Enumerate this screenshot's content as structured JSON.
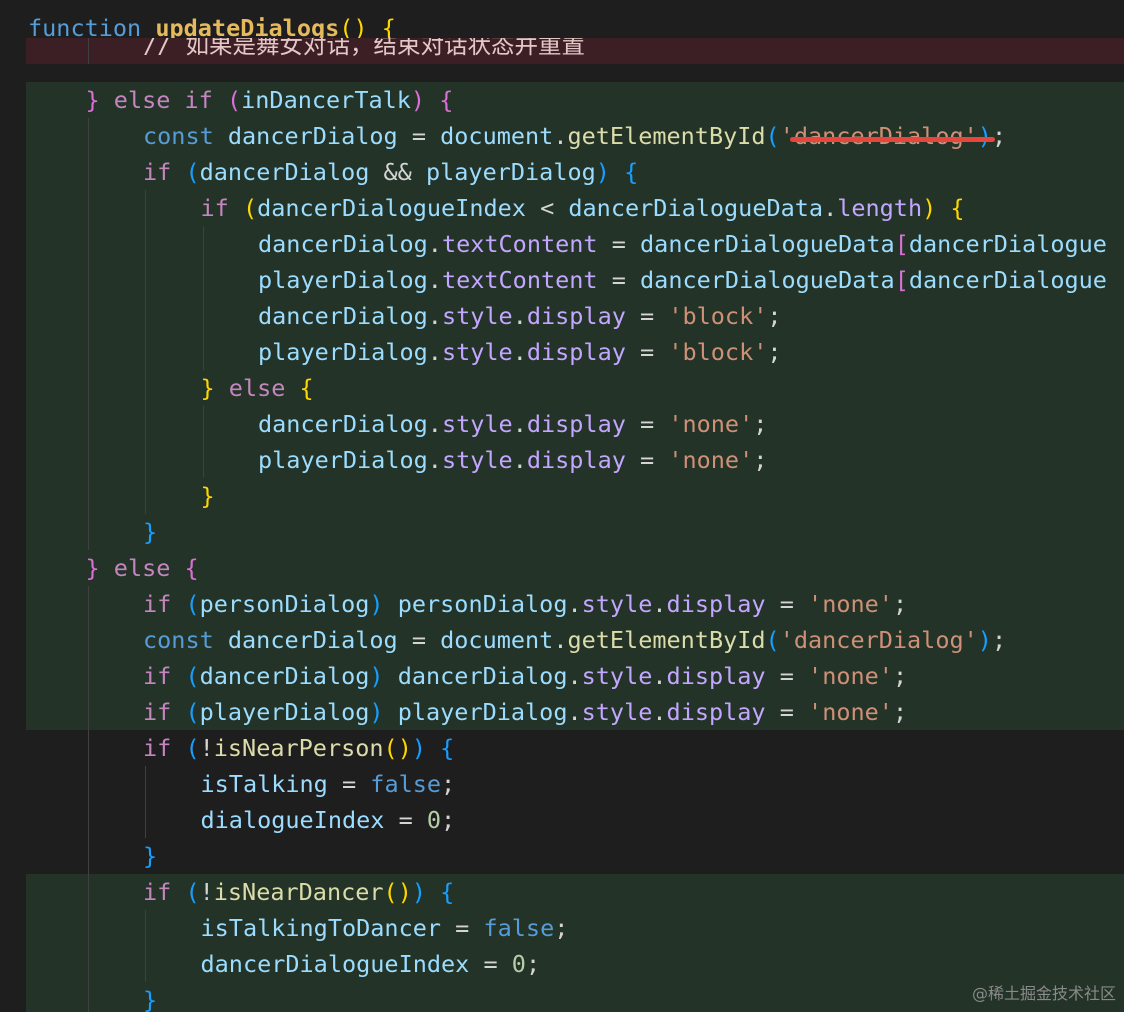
{
  "editor": {
    "watermark": "@稀土掘金技术社区"
  },
  "lines": [
    {
      "kind": "plain",
      "indent": 0,
      "tokens": [
        {
          "t": "function ",
          "c": "kw"
        },
        {
          "t": "updateDialogs",
          "c": "fn-def"
        },
        {
          "t": "()",
          "c": "b1"
        },
        {
          "t": " ",
          "c": "op"
        },
        {
          "t": "{",
          "c": "b1"
        }
      ]
    },
    {
      "kind": "removed",
      "indent": 2,
      "tokens": [
        {
          "t": "// 如果是舞女对话，结束对话状态并重置",
          "c": "comment"
        }
      ]
    },
    {
      "kind": "added",
      "indent": 1,
      "tokens": [
        {
          "t": "} ",
          "c": "b2"
        },
        {
          "t": "else if ",
          "c": "kw-flow"
        },
        {
          "t": "(",
          "c": "b2"
        },
        {
          "t": "inDancerTalk",
          "c": "var"
        },
        {
          "t": ")",
          "c": "b2"
        },
        {
          "t": " ",
          "c": "op"
        },
        {
          "t": "{",
          "c": "b2"
        }
      ]
    },
    {
      "kind": "added",
      "indent": 2,
      "tokens": [
        {
          "t": "const ",
          "c": "kw"
        },
        {
          "t": "dancerDialog",
          "c": "var"
        },
        {
          "t": " = ",
          "c": "op"
        },
        {
          "t": "document",
          "c": "var"
        },
        {
          "t": ".",
          "c": "op"
        },
        {
          "t": "getElementById",
          "c": "fn"
        },
        {
          "t": "(",
          "c": "b3"
        },
        {
          "t": "'dancerDialog'",
          "c": "str"
        },
        {
          "t": ")",
          "c": "b3"
        },
        {
          "t": ";",
          "c": "op"
        }
      ]
    },
    {
      "kind": "added",
      "indent": 2,
      "tokens": [
        {
          "t": "if ",
          "c": "kw-flow"
        },
        {
          "t": "(",
          "c": "b3"
        },
        {
          "t": "dancerDialog",
          "c": "var"
        },
        {
          "t": " && ",
          "c": "op"
        },
        {
          "t": "playerDialog",
          "c": "var"
        },
        {
          "t": ")",
          "c": "b3"
        },
        {
          "t": " ",
          "c": "op"
        },
        {
          "t": "{",
          "c": "b3"
        }
      ]
    },
    {
      "kind": "added",
      "indent": 3,
      "tokens": [
        {
          "t": "if ",
          "c": "kw-flow"
        },
        {
          "t": "(",
          "c": "b1"
        },
        {
          "t": "dancerDialogueIndex",
          "c": "var"
        },
        {
          "t": " < ",
          "c": "op"
        },
        {
          "t": "dancerDialogueData",
          "c": "var"
        },
        {
          "t": ".",
          "c": "op"
        },
        {
          "t": "length",
          "c": "prop"
        },
        {
          "t": ")",
          "c": "b1"
        },
        {
          "t": " ",
          "c": "op"
        },
        {
          "t": "{",
          "c": "b1"
        }
      ]
    },
    {
      "kind": "added",
      "indent": 4,
      "tokens": [
        {
          "t": "dancerDialog",
          "c": "var"
        },
        {
          "t": ".",
          "c": "op"
        },
        {
          "t": "textContent",
          "c": "prop"
        },
        {
          "t": " = ",
          "c": "op"
        },
        {
          "t": "dancerDialogueData",
          "c": "var"
        },
        {
          "t": "[",
          "c": "b2"
        },
        {
          "t": "dancerDialogue",
          "c": "var"
        }
      ]
    },
    {
      "kind": "added",
      "indent": 4,
      "tokens": [
        {
          "t": "playerDialog",
          "c": "var"
        },
        {
          "t": ".",
          "c": "op"
        },
        {
          "t": "textContent",
          "c": "prop"
        },
        {
          "t": " = ",
          "c": "op"
        },
        {
          "t": "dancerDialogueData",
          "c": "var"
        },
        {
          "t": "[",
          "c": "b2"
        },
        {
          "t": "dancerDialogue",
          "c": "var"
        }
      ]
    },
    {
      "kind": "added",
      "indent": 4,
      "tokens": [
        {
          "t": "dancerDialog",
          "c": "var"
        },
        {
          "t": ".",
          "c": "op"
        },
        {
          "t": "style",
          "c": "prop"
        },
        {
          "t": ".",
          "c": "op"
        },
        {
          "t": "display",
          "c": "prop"
        },
        {
          "t": " = ",
          "c": "op"
        },
        {
          "t": "'block'",
          "c": "str"
        },
        {
          "t": ";",
          "c": "op"
        }
      ]
    },
    {
      "kind": "added",
      "indent": 4,
      "tokens": [
        {
          "t": "playerDialog",
          "c": "var"
        },
        {
          "t": ".",
          "c": "op"
        },
        {
          "t": "style",
          "c": "prop"
        },
        {
          "t": ".",
          "c": "op"
        },
        {
          "t": "display",
          "c": "prop"
        },
        {
          "t": " = ",
          "c": "op"
        },
        {
          "t": "'block'",
          "c": "str"
        },
        {
          "t": ";",
          "c": "op"
        }
      ]
    },
    {
      "kind": "added",
      "indent": 3,
      "tokens": [
        {
          "t": "} ",
          "c": "b1"
        },
        {
          "t": "else ",
          "c": "kw-flow"
        },
        {
          "t": "{",
          "c": "b1"
        }
      ]
    },
    {
      "kind": "added",
      "indent": 4,
      "tokens": [
        {
          "t": "dancerDialog",
          "c": "var"
        },
        {
          "t": ".",
          "c": "op"
        },
        {
          "t": "style",
          "c": "prop"
        },
        {
          "t": ".",
          "c": "op"
        },
        {
          "t": "display",
          "c": "prop"
        },
        {
          "t": " = ",
          "c": "op"
        },
        {
          "t": "'none'",
          "c": "str"
        },
        {
          "t": ";",
          "c": "op"
        }
      ]
    },
    {
      "kind": "added",
      "indent": 4,
      "tokens": [
        {
          "t": "playerDialog",
          "c": "var"
        },
        {
          "t": ".",
          "c": "op"
        },
        {
          "t": "style",
          "c": "prop"
        },
        {
          "t": ".",
          "c": "op"
        },
        {
          "t": "display",
          "c": "prop"
        },
        {
          "t": " = ",
          "c": "op"
        },
        {
          "t": "'none'",
          "c": "str"
        },
        {
          "t": ";",
          "c": "op"
        }
      ]
    },
    {
      "kind": "added",
      "indent": 3,
      "tokens": [
        {
          "t": "}",
          "c": "b1"
        }
      ]
    },
    {
      "kind": "added",
      "indent": 2,
      "tokens": [
        {
          "t": "}",
          "c": "b3"
        }
      ]
    },
    {
      "kind": "added",
      "indent": 1,
      "tokens": [
        {
          "t": "} ",
          "c": "b2"
        },
        {
          "t": "else ",
          "c": "kw-flow"
        },
        {
          "t": "{",
          "c": "b2"
        }
      ]
    },
    {
      "kind": "added",
      "indent": 2,
      "tokens": [
        {
          "t": "if ",
          "c": "kw-flow"
        },
        {
          "t": "(",
          "c": "b3"
        },
        {
          "t": "personDialog",
          "c": "var"
        },
        {
          "t": ")",
          "c": "b3"
        },
        {
          "t": " ",
          "c": "op"
        },
        {
          "t": "personDialog",
          "c": "var"
        },
        {
          "t": ".",
          "c": "op"
        },
        {
          "t": "style",
          "c": "prop"
        },
        {
          "t": ".",
          "c": "op"
        },
        {
          "t": "display",
          "c": "prop"
        },
        {
          "t": " = ",
          "c": "op"
        },
        {
          "t": "'none'",
          "c": "str"
        },
        {
          "t": ";",
          "c": "op"
        }
      ]
    },
    {
      "kind": "added",
      "indent": 2,
      "tokens": [
        {
          "t": "const ",
          "c": "kw"
        },
        {
          "t": "dancerDialog",
          "c": "var"
        },
        {
          "t": " = ",
          "c": "op"
        },
        {
          "t": "document",
          "c": "var"
        },
        {
          "t": ".",
          "c": "op"
        },
        {
          "t": "getElementById",
          "c": "fn"
        },
        {
          "t": "(",
          "c": "b3"
        },
        {
          "t": "'dancerDialog'",
          "c": "str"
        },
        {
          "t": ")",
          "c": "b3"
        },
        {
          "t": ";",
          "c": "op"
        }
      ]
    },
    {
      "kind": "added",
      "indent": 2,
      "tokens": [
        {
          "t": "if ",
          "c": "kw-flow"
        },
        {
          "t": "(",
          "c": "b3"
        },
        {
          "t": "dancerDialog",
          "c": "var"
        },
        {
          "t": ")",
          "c": "b3"
        },
        {
          "t": " ",
          "c": "op"
        },
        {
          "t": "dancerDialog",
          "c": "var"
        },
        {
          "t": ".",
          "c": "op"
        },
        {
          "t": "style",
          "c": "prop"
        },
        {
          "t": ".",
          "c": "op"
        },
        {
          "t": "display",
          "c": "prop"
        },
        {
          "t": " = ",
          "c": "op"
        },
        {
          "t": "'none'",
          "c": "str"
        },
        {
          "t": ";",
          "c": "op"
        }
      ]
    },
    {
      "kind": "added",
      "indent": 2,
      "tokens": [
        {
          "t": "if ",
          "c": "kw-flow"
        },
        {
          "t": "(",
          "c": "b3"
        },
        {
          "t": "playerDialog",
          "c": "var"
        },
        {
          "t": ")",
          "c": "b3"
        },
        {
          "t": " ",
          "c": "op"
        },
        {
          "t": "playerDialog",
          "c": "var"
        },
        {
          "t": ".",
          "c": "op"
        },
        {
          "t": "style",
          "c": "prop"
        },
        {
          "t": ".",
          "c": "op"
        },
        {
          "t": "display",
          "c": "prop"
        },
        {
          "t": " = ",
          "c": "op"
        },
        {
          "t": "'none'",
          "c": "str"
        },
        {
          "t": ";",
          "c": "op"
        }
      ]
    },
    {
      "kind": "plain",
      "indent": 2,
      "tokens": [
        {
          "t": "if ",
          "c": "kw-flow"
        },
        {
          "t": "(",
          "c": "b3"
        },
        {
          "t": "!",
          "c": "op"
        },
        {
          "t": "isNearPerson",
          "c": "fn"
        },
        {
          "t": "()",
          "c": "b1"
        },
        {
          "t": ")",
          "c": "b3"
        },
        {
          "t": " ",
          "c": "op"
        },
        {
          "t": "{",
          "c": "b3"
        }
      ]
    },
    {
      "kind": "plain",
      "indent": 3,
      "tokens": [
        {
          "t": "isTalking",
          "c": "var"
        },
        {
          "t": " = ",
          "c": "op"
        },
        {
          "t": "false",
          "c": "kw"
        },
        {
          "t": ";",
          "c": "op"
        }
      ]
    },
    {
      "kind": "plain",
      "indent": 3,
      "tokens": [
        {
          "t": "dialogueIndex",
          "c": "var"
        },
        {
          "t": " = ",
          "c": "op"
        },
        {
          "t": "0",
          "c": "num"
        },
        {
          "t": ";",
          "c": "op"
        }
      ]
    },
    {
      "kind": "plain",
      "indent": 2,
      "tokens": [
        {
          "t": "}",
          "c": "b3"
        }
      ]
    },
    {
      "kind": "added",
      "indent": 2,
      "tokens": [
        {
          "t": "if ",
          "c": "kw-flow"
        },
        {
          "t": "(",
          "c": "b3"
        },
        {
          "t": "!",
          "c": "op"
        },
        {
          "t": "isNearDancer",
          "c": "fn"
        },
        {
          "t": "()",
          "c": "b1"
        },
        {
          "t": ")",
          "c": "b3"
        },
        {
          "t": " ",
          "c": "op"
        },
        {
          "t": "{",
          "c": "b3"
        }
      ]
    },
    {
      "kind": "added",
      "indent": 3,
      "tokens": [
        {
          "t": "isTalkingToDancer",
          "c": "var"
        },
        {
          "t": " = ",
          "c": "op"
        },
        {
          "t": "false",
          "c": "kw"
        },
        {
          "t": ";",
          "c": "op"
        }
      ]
    },
    {
      "kind": "added",
      "indent": 3,
      "tokens": [
        {
          "t": "dancerDialogueIndex",
          "c": "var"
        },
        {
          "t": " = ",
          "c": "op"
        },
        {
          "t": "0",
          "c": "num"
        },
        {
          "t": ";",
          "c": "op"
        }
      ]
    },
    {
      "kind": "added",
      "indent": 2,
      "tokens": [
        {
          "t": "}",
          "c": "b3"
        }
      ]
    },
    {
      "kind": "plain",
      "indent": 1,
      "tokens": [
        {
          "t": "}",
          "c": "b2"
        }
      ]
    }
  ]
}
